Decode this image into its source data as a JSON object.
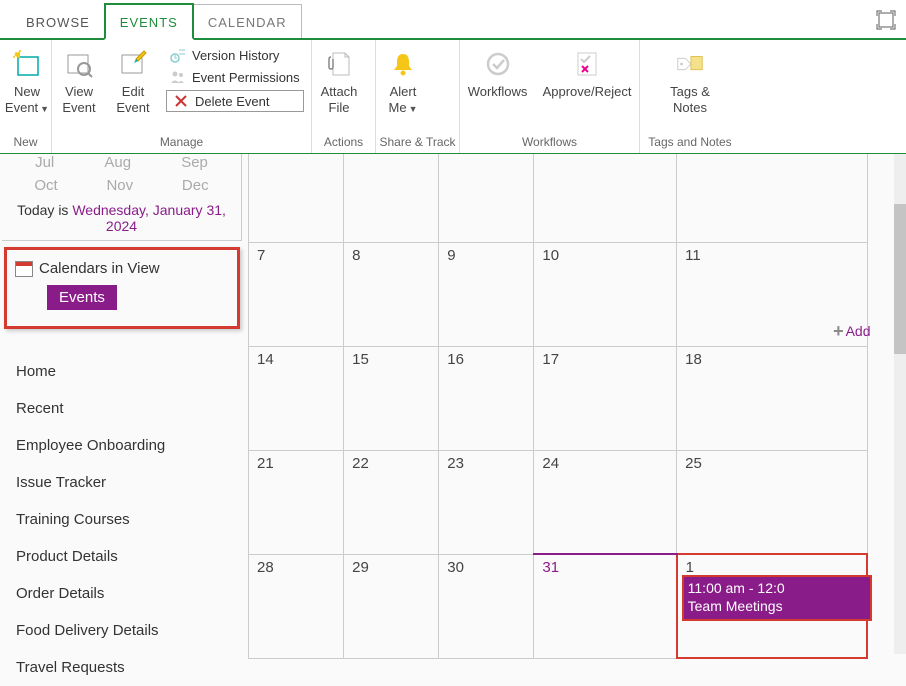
{
  "tabs": {
    "browse": "BROWSE",
    "events": "EVENTS",
    "calendar": "CALENDAR"
  },
  "ribbon": {
    "new_event": "New\nEvent",
    "new_group": "New",
    "view_event": "View\nEvent",
    "edit_event": "Edit\nEvent",
    "version_history": "Version History",
    "event_permissions": "Event Permissions",
    "delete_event": "Delete Event",
    "manage_group": "Manage",
    "attach_file": "Attach\nFile",
    "actions_group": "Actions",
    "alert_me": "Alert\nMe",
    "share_track_group": "Share & Track",
    "workflows": "Workflows",
    "approve_reject": "Approve/Reject",
    "workflows_group": "Workflows",
    "tags_notes": "Tags &\nNotes",
    "tags_group": "Tags and Notes"
  },
  "months": {
    "row1": [
      "Jul",
      "Aug",
      "Sep"
    ],
    "row2": [
      "Oct",
      "Nov",
      "Dec"
    ],
    "today_prefix": "Today is ",
    "today_date": "Wednesday, January 31, 2024"
  },
  "civ": {
    "title": "Calendars in View",
    "chip": "Events"
  },
  "nav": [
    "Home",
    "Recent",
    "Employee Onboarding",
    "Issue Tracker",
    "Training Courses",
    "Product Details",
    "Order Details",
    "Food Delivery Details",
    "Travel Requests"
  ],
  "calendar": {
    "add_label": "Add",
    "weeks": [
      [
        "",
        "",
        "",
        "",
        ""
      ],
      [
        "7",
        "8",
        "9",
        "10",
        "11"
      ],
      [
        "14",
        "15",
        "16",
        "17",
        "18"
      ],
      [
        "21",
        "22",
        "23",
        "24",
        "25"
      ],
      [
        "28",
        "29",
        "30",
        "31",
        "1"
      ]
    ],
    "today_cell": "31",
    "event": {
      "time": "11:00 am - 12:0",
      "title": "Team Meetings"
    }
  }
}
